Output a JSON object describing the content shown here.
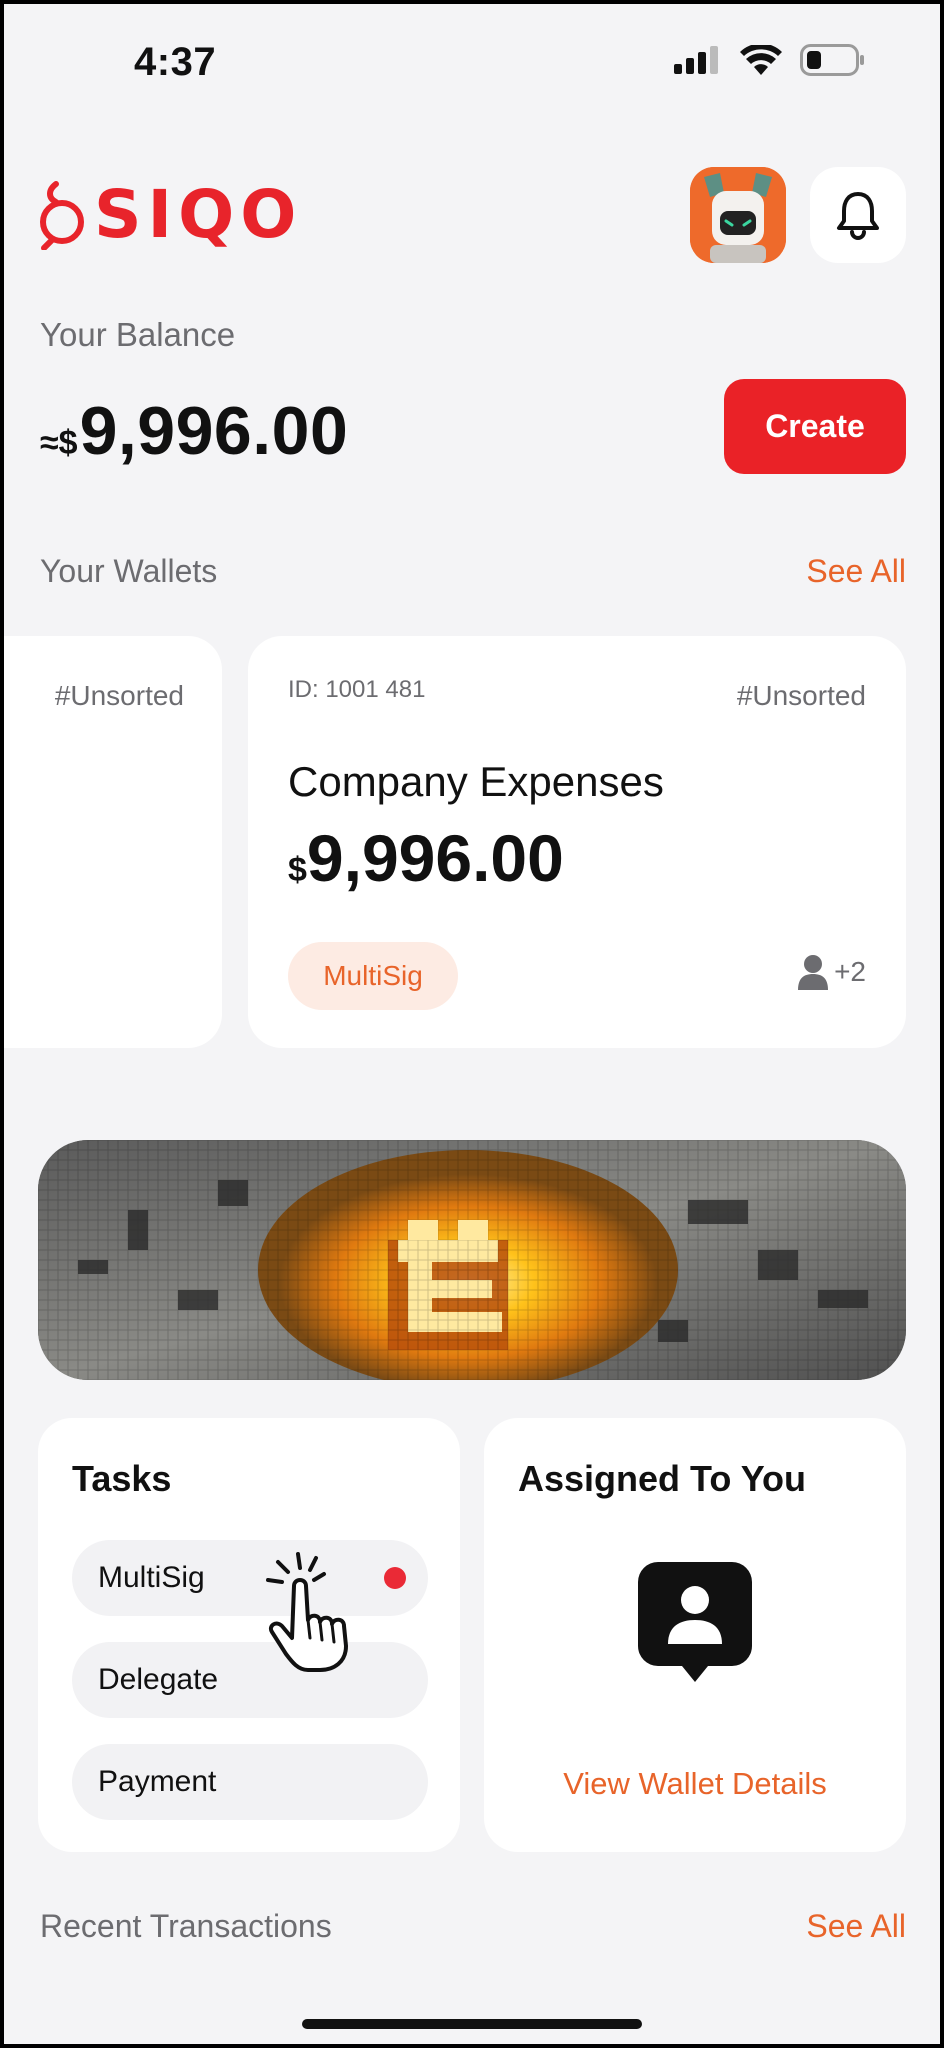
{
  "status_bar": {
    "time": "4:37"
  },
  "header": {
    "logo_text": "SIQO"
  },
  "balance": {
    "label": "Your Balance",
    "prefix": "≈$",
    "value": "9,996.00",
    "create_label": "Create"
  },
  "wallets": {
    "title": "Your Wallets",
    "see_all": "See All",
    "partial_card": {
      "tag": "#Unsorted"
    },
    "main_card": {
      "id": "ID: 1001 481",
      "tag": "#Unsorted",
      "name": "Company Expenses",
      "currency": "$",
      "amount": "9,996.00",
      "badge": "MultiSig",
      "members": "+2"
    }
  },
  "tasks": {
    "title": "Tasks",
    "items": [
      {
        "label": "MultiSig"
      },
      {
        "label": "Delegate"
      },
      {
        "label": "Payment"
      }
    ]
  },
  "assigned": {
    "title": "Assigned To You",
    "link": "View Wallet Details"
  },
  "transactions": {
    "title": "Recent Transactions",
    "see_all": "See All"
  },
  "colors": {
    "brand_red": "#ea2227",
    "accent_orange": "#e8642a",
    "background": "#f4f4f6",
    "badge_bg": "#fdebe3"
  }
}
